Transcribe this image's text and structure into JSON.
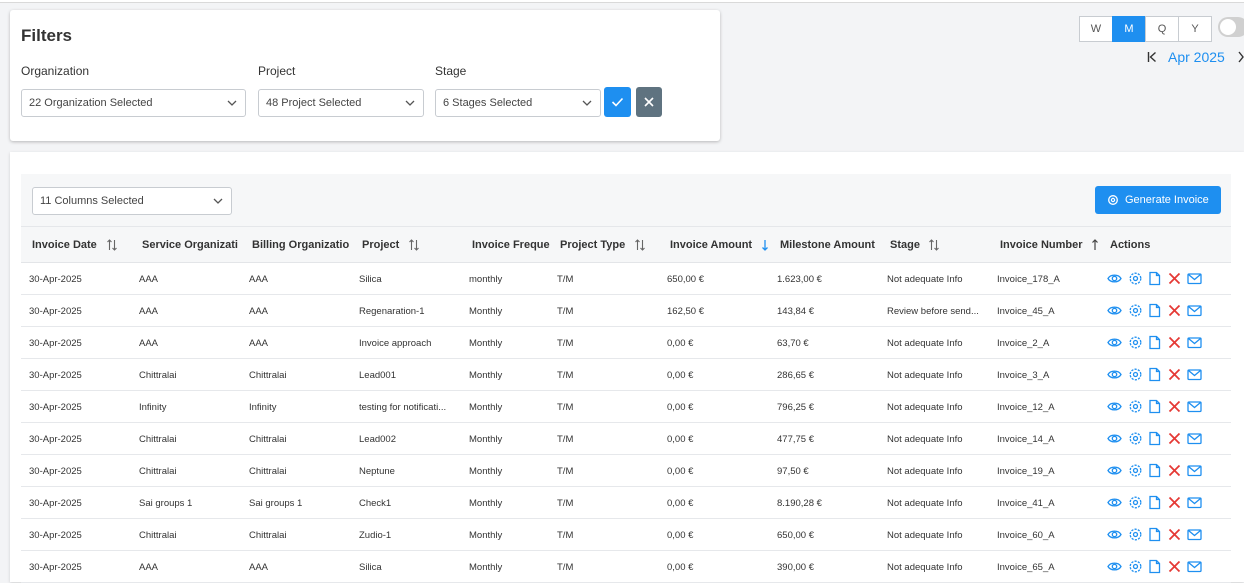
{
  "filters": {
    "title": "Filters",
    "organization": {
      "label": "Organization",
      "value": "22 Organization Selected"
    },
    "project": {
      "label": "Project",
      "value": "48 Project Selected"
    },
    "stage": {
      "label": "Stage",
      "value": "6 Stages Selected"
    }
  },
  "period": {
    "buttons": [
      "W",
      "M",
      "Q",
      "Y"
    ],
    "active": "M",
    "month": "Apr 2025"
  },
  "toolbar": {
    "columns_select": "11 Columns Selected",
    "generate_label": "Generate Invoice"
  },
  "table": {
    "headers": [
      "Invoice Date",
      "Service Organizati",
      "Billing Organizatio",
      "Project",
      "Invoice Freque",
      "Project Type",
      "Invoice Amount",
      "Milestone Amount",
      "Stage",
      "Invoice Number",
      "Actions"
    ],
    "rows": [
      [
        "30-Apr-2025",
        "AAA",
        "AAA",
        "Silica",
        "monthly",
        "T/M",
        "650,00 €",
        "1.623,00 €",
        "Not adequate Info",
        "Invoice_178_A"
      ],
      [
        "30-Apr-2025",
        "AAA",
        "AAA",
        "Regenaration-1",
        "Monthly",
        "T/M",
        "162,50 €",
        "143,84 €",
        "Review before send...",
        "Invoice_45_A"
      ],
      [
        "30-Apr-2025",
        "AAA",
        "AAA",
        "Invoice approach",
        "Monthly",
        "T/M",
        "0,00 €",
        "63,70 €",
        "Not adequate Info",
        "Invoice_2_A"
      ],
      [
        "30-Apr-2025",
        "Chittralai",
        "Chittralai",
        "Lead001",
        "Monthly",
        "T/M",
        "0,00 €",
        "286,65 €",
        "Not adequate Info",
        "Invoice_3_A"
      ],
      [
        "30-Apr-2025",
        "Infinity",
        "Infinity",
        "testing for notificati...",
        "Monthly",
        "T/M",
        "0,00 €",
        "796,25 €",
        "Not adequate Info",
        "Invoice_12_A"
      ],
      [
        "30-Apr-2025",
        "Chittralai",
        "Chittralai",
        "Lead002",
        "Monthly",
        "T/M",
        "0,00 €",
        "477,75 €",
        "Not adequate Info",
        "Invoice_14_A"
      ],
      [
        "30-Apr-2025",
        "Chittralai",
        "Chittralai",
        "Neptune",
        "Monthly",
        "T/M",
        "0,00 €",
        "97,50 €",
        "Not adequate Info",
        "Invoice_19_A"
      ],
      [
        "30-Apr-2025",
        "Sai groups 1",
        "Sai groups 1",
        "Check1",
        "Monthly",
        "T/M",
        "0,00 €",
        "8.190,28 €",
        "Not adequate Info",
        "Invoice_41_A"
      ],
      [
        "30-Apr-2025",
        "Chittralai",
        "Chittralai",
        "Zudio-1",
        "Monthly",
        "T/M",
        "0,00 €",
        "650,00 €",
        "Not adequate Info",
        "Invoice_60_A"
      ],
      [
        "30-Apr-2025",
        "AAA",
        "AAA",
        "Silica",
        "Monthly",
        "T/M",
        "0,00 €",
        "390,00 €",
        "Not adequate Info",
        "Invoice_65_A"
      ]
    ],
    "actions": [
      "view-icon",
      "settings-icon",
      "document-icon",
      "delete-icon",
      "email-icon"
    ]
  },
  "colors": {
    "accent": "#1e8ff0",
    "danger": "#e53935",
    "clear_button": "#5f7380"
  }
}
